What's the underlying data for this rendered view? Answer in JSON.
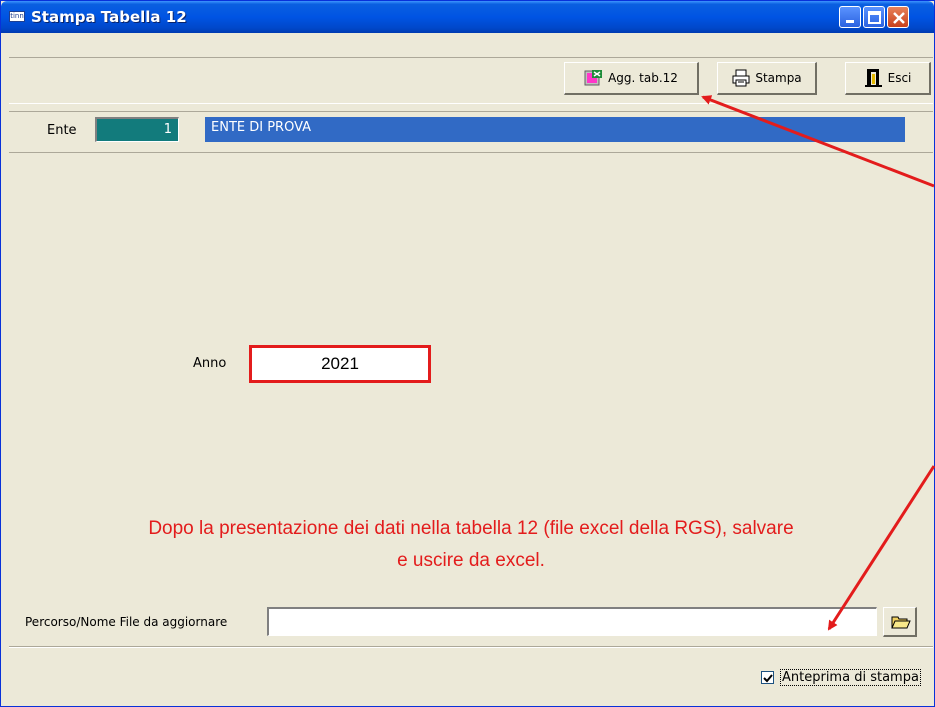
{
  "window": {
    "title": "Stampa Tabella 12",
    "app_icon_text": "tinn"
  },
  "toolbar": {
    "agg_label": "Agg. tab.12",
    "stampa_label": "Stampa",
    "esci_label": "Esci"
  },
  "ente": {
    "label": "Ente",
    "code": "1",
    "name": "ENTE DI PROVA"
  },
  "anno": {
    "label": "Anno",
    "value": "2021"
  },
  "note": {
    "line1": "Dopo la presentazione dei dati nella tabella 12 (file excel della RGS), salvare",
    "line2": "e uscire da excel."
  },
  "path": {
    "label": "Percorso/Nome File da aggiornare",
    "value": ""
  },
  "preview": {
    "label": "Anteprima di stampa",
    "checked": true
  },
  "colors": {
    "annotation_red": "#e31c1c",
    "ente_code_bg": "#127b7c",
    "ente_name_bg": "#316ac5",
    "title_bar": "#0054e3",
    "window_bg": "#ece9d8"
  }
}
